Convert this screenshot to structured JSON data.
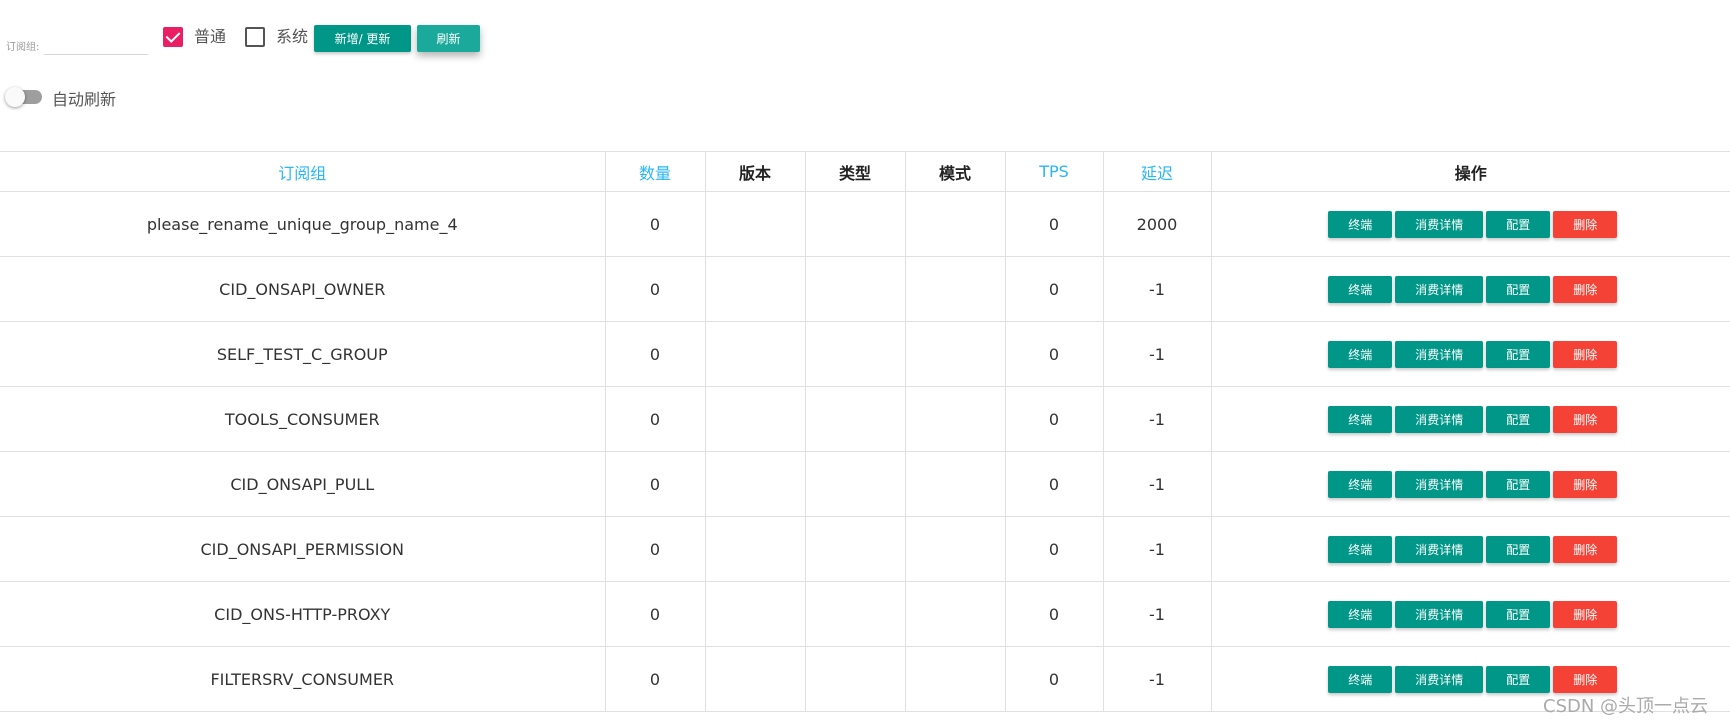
{
  "toolbar": {
    "search_label": "订阅组:",
    "search_value": "",
    "checkbox_normal": {
      "label": "普通",
      "checked": true
    },
    "checkbox_system": {
      "label": "系统",
      "checked": false
    },
    "add_update_label": "新增/ 更新",
    "refresh_label": "刷新",
    "auto_refresh_label": "自动刷新",
    "auto_refresh_on": false
  },
  "table": {
    "headers": [
      "订阅组",
      "数量",
      "版本",
      "类型",
      "模式",
      "TPS",
      "延迟",
      "操作"
    ],
    "rows": [
      {
        "group": "please_rename_unique_group_name_4",
        "count": "0",
        "version": "",
        "type": "",
        "mode": "",
        "tps": "0",
        "delay": "2000"
      },
      {
        "group": "CID_ONSAPI_OWNER",
        "count": "0",
        "version": "",
        "type": "",
        "mode": "",
        "tps": "0",
        "delay": "-1"
      },
      {
        "group": "SELF_TEST_C_GROUP",
        "count": "0",
        "version": "",
        "type": "",
        "mode": "",
        "tps": "0",
        "delay": "-1"
      },
      {
        "group": "TOOLS_CONSUMER",
        "count": "0",
        "version": "",
        "type": "",
        "mode": "",
        "tps": "0",
        "delay": "-1"
      },
      {
        "group": "CID_ONSAPI_PULL",
        "count": "0",
        "version": "",
        "type": "",
        "mode": "",
        "tps": "0",
        "delay": "-1"
      },
      {
        "group": "CID_ONSAPI_PERMISSION",
        "count": "0",
        "version": "",
        "type": "",
        "mode": "",
        "tps": "0",
        "delay": "-1"
      },
      {
        "group": "CID_ONS-HTTP-PROXY",
        "count": "0",
        "version": "",
        "type": "",
        "mode": "",
        "tps": "0",
        "delay": "-1"
      },
      {
        "group": "FILTERSRV_CONSUMER",
        "count": "0",
        "version": "",
        "type": "",
        "mode": "",
        "tps": "0",
        "delay": "-1"
      }
    ],
    "actions": {
      "terminal": "终端",
      "consume_detail": "消费详情",
      "config": "配置",
      "delete": "删除"
    }
  },
  "colors": {
    "primary": "#009688",
    "danger": "#f44336",
    "checkbox": "#e91e63",
    "header_link": "#29b6f6"
  },
  "watermark": "CSDN @头顶一点云"
}
